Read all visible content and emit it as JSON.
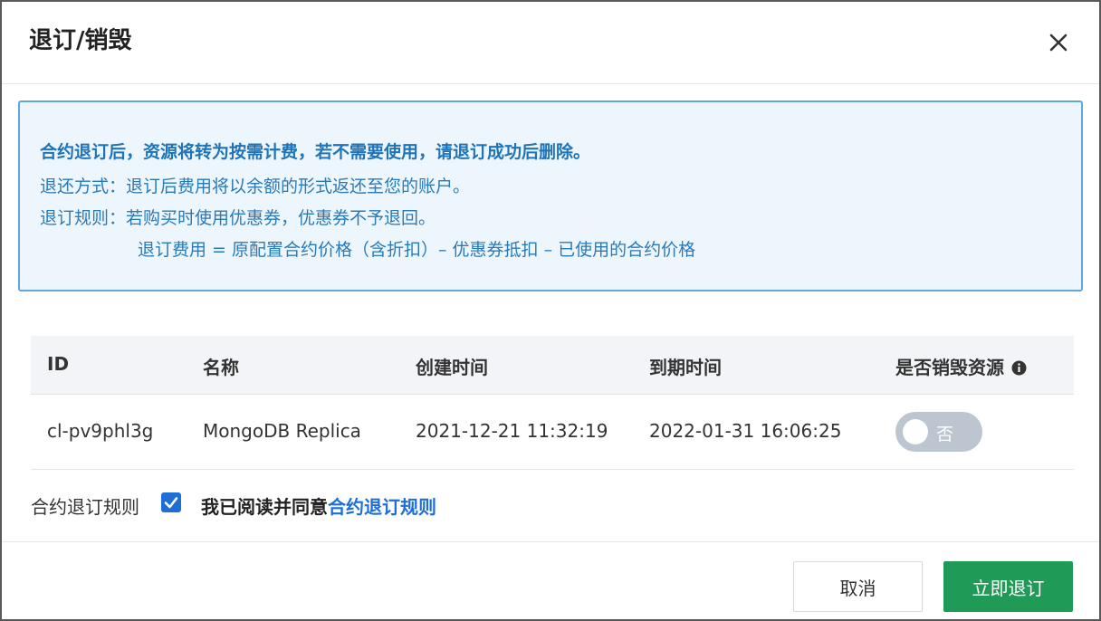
{
  "dialog": {
    "title": "退订/销毁"
  },
  "notice": {
    "headline": "合约退订后，资源将转为按需计费，若不需要使用，请退订成功后删除。",
    "refund_method": "退还方式：退订后费用将以余额的形式返还至您的账户。",
    "refund_rule": "退订规则：若购买时使用优惠券，优惠券不予退回。",
    "refund_formula": "退订费用 = 原配置合约价格（含折扣）– 优惠券抵扣 – 已使用的合约价格"
  },
  "table": {
    "headers": {
      "id": "ID",
      "name": "名称",
      "created": "创建时间",
      "expires": "到期时间",
      "destroy": "是否销毁资源"
    },
    "rows": [
      {
        "id": "cl-pv9phl3g",
        "name": "MongoDB Replica",
        "created": "2021-12-21 11:32:19",
        "expires": "2022-01-31 16:06:25",
        "destroy_toggle": "否"
      }
    ]
  },
  "agreement": {
    "label": "合约退订规则",
    "checked": true,
    "text": "我已阅读并同意",
    "link_text": "合约退订规则"
  },
  "footer": {
    "cancel_label": "取消",
    "confirm_label": "立即退订"
  },
  "colors": {
    "primary_green": "#1f9b57",
    "link_blue": "#1d6fd6",
    "notice_bg": "#edf6fc",
    "notice_border": "#5fa6d9"
  },
  "icons": {
    "close": "close-icon",
    "info": "info-icon",
    "check": "check-icon"
  }
}
